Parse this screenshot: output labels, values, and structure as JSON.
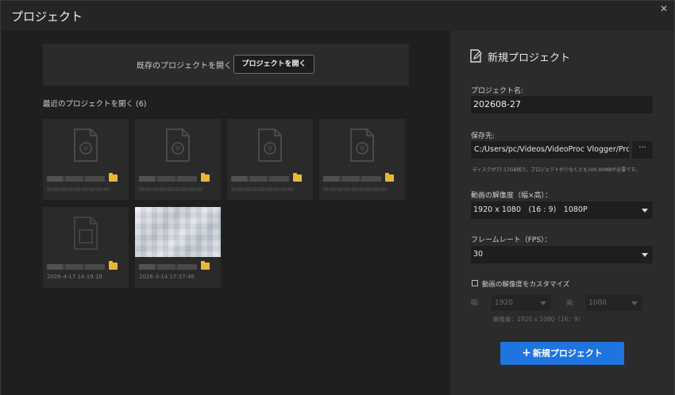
{
  "window": {
    "title": "プロジェクト",
    "close_icon": "close-icon"
  },
  "open_existing": {
    "text": "既存のプロジェクトを開く",
    "button_label": "プロジェクトを開く"
  },
  "recent": {
    "title": "最近のプロジェクトを開く",
    "count": "(6)",
    "items": [
      {
        "thumb": "project-file-icon",
        "date": ""
      },
      {
        "thumb": "project-file-icon",
        "date": ""
      },
      {
        "thumb": "project-file-icon",
        "date": ""
      },
      {
        "thumb": "project-file-icon",
        "date": ""
      },
      {
        "thumb": "missing-file-icon",
        "date": "2026-4-17 14:19:16"
      },
      {
        "thumb": "image",
        "date": "2026-3-14 17:27:46"
      }
    ]
  },
  "new_project": {
    "header": "新規プロジェクト",
    "name_label": "プロジェクト名:",
    "name_value": "202608-27",
    "save_label": "保存先:",
    "save_path": "C:/Users/pc/Videos/VideoProc Vlogger/Project",
    "browse_label": "···",
    "disk_note": "ディスクが77.17GB残り，プロジェクトが少なくとも100.00MBが必要です。",
    "resolution_label": "動画の解像度（幅×高）：",
    "resolution_value": "1920 x 1080　(16 : 9)　1080P",
    "framerate_label": "フレームレート（FPS）：",
    "framerate_value": "30",
    "customize_label": "動画の解像度をカスタマイズ",
    "width_label": "幅:",
    "width_value": "1920",
    "height_label": "高:",
    "height_value": "1080",
    "resolution_note": "解像度：1920 x 1080（16：9）",
    "create_button": "新規プロジェクト"
  },
  "colors": {
    "accent": "#1f74de",
    "folder": "#e9b637"
  }
}
